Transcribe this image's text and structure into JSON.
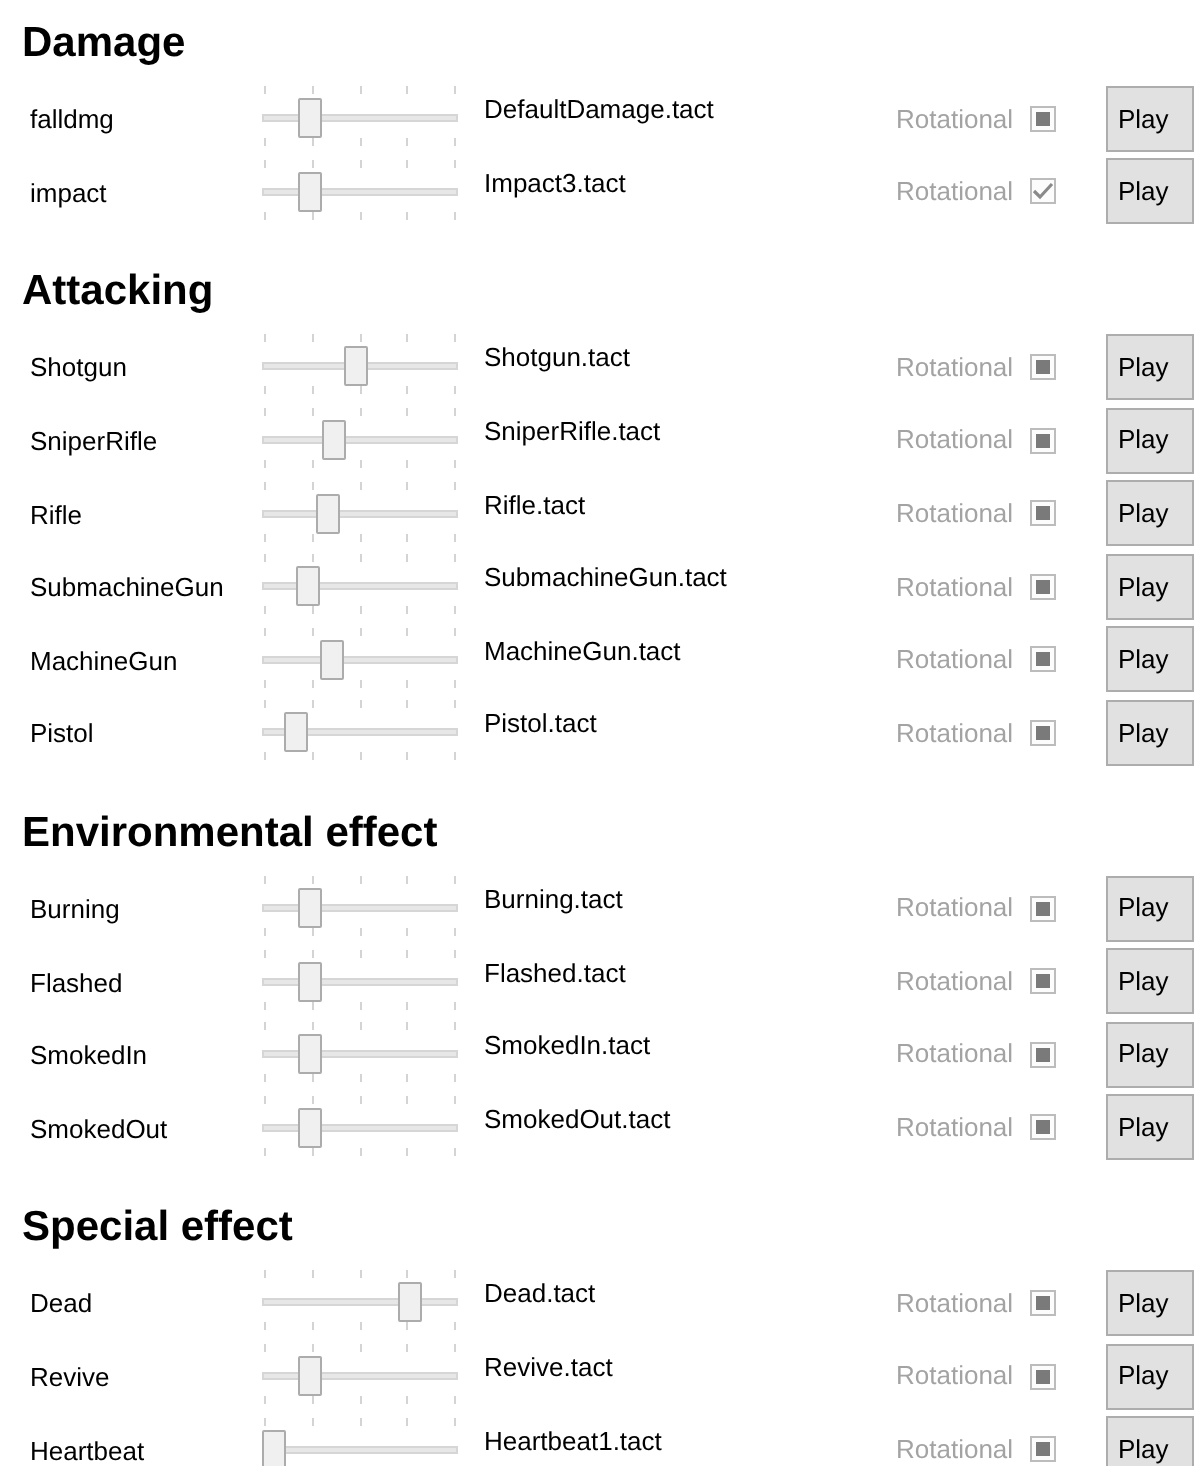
{
  "sections": [
    {
      "title": "Damage",
      "rows": [
        {
          "name": "falldmg",
          "level": 0.21,
          "file": "DefaultDamage.tact",
          "option": "Rotational",
          "checked": false,
          "indeterminate": true,
          "button": "Play"
        },
        {
          "name": "impact",
          "level": 0.21,
          "file": "Impact3.tact",
          "option": "Rotational",
          "checked": true,
          "indeterminate": false,
          "button": "Play"
        }
      ]
    },
    {
      "title": "Attacking",
      "rows": [
        {
          "name": "Shotgun",
          "level": 0.48,
          "file": "Shotgun.tact",
          "option": "Rotational",
          "checked": false,
          "indeterminate": true,
          "button": "Play"
        },
        {
          "name": "SniperRifle",
          "level": 0.35,
          "file": "SniperRifle.tact",
          "option": "Rotational",
          "checked": false,
          "indeterminate": true,
          "button": "Play"
        },
        {
          "name": "Rifle",
          "level": 0.31,
          "file": "Rifle.tact",
          "option": "Rotational",
          "checked": false,
          "indeterminate": true,
          "button": "Play"
        },
        {
          "name": "SubmachineGun",
          "level": 0.2,
          "file": "SubmachineGun.tact",
          "option": "Rotational",
          "checked": false,
          "indeterminate": true,
          "button": "Play"
        },
        {
          "name": "MachineGun",
          "level": 0.34,
          "file": "MachineGun.tact",
          "option": "Rotational",
          "checked": false,
          "indeterminate": true,
          "button": "Play"
        },
        {
          "name": "Pistol",
          "level": 0.13,
          "file": "Pistol.tact",
          "option": "Rotational",
          "checked": false,
          "indeterminate": true,
          "button": "Play"
        }
      ]
    },
    {
      "title": "Environmental effect",
      "rows": [
        {
          "name": "Burning",
          "level": 0.21,
          "file": "Burning.tact",
          "option": "Rotational",
          "checked": false,
          "indeterminate": true,
          "button": "Play"
        },
        {
          "name": "Flashed",
          "level": 0.21,
          "file": "Flashed.tact",
          "option": "Rotational",
          "checked": false,
          "indeterminate": true,
          "button": "Play"
        },
        {
          "name": "SmokedIn",
          "level": 0.21,
          "file": "SmokedIn.tact",
          "option": "Rotational",
          "checked": false,
          "indeterminate": true,
          "button": "Play"
        },
        {
          "name": "SmokedOut",
          "level": 0.21,
          "file": "SmokedOut.tact",
          "option": "Rotational",
          "checked": false,
          "indeterminate": true,
          "button": "Play"
        }
      ]
    },
    {
      "title": "Special effect",
      "rows": [
        {
          "name": "Dead",
          "level": 0.79,
          "file": "Dead.tact",
          "option": "Rotational",
          "checked": false,
          "indeterminate": true,
          "button": "Play"
        },
        {
          "name": "Revive",
          "level": 0.21,
          "file": "Revive.tact",
          "option": "Rotational",
          "checked": false,
          "indeterminate": true,
          "button": "Play"
        },
        {
          "name": "Heartbeat",
          "level": 0,
          "file": "Heartbeat1.tact",
          "option": "Rotational",
          "checked": false,
          "indeterminate": true,
          "button": "Play"
        }
      ]
    }
  ]
}
